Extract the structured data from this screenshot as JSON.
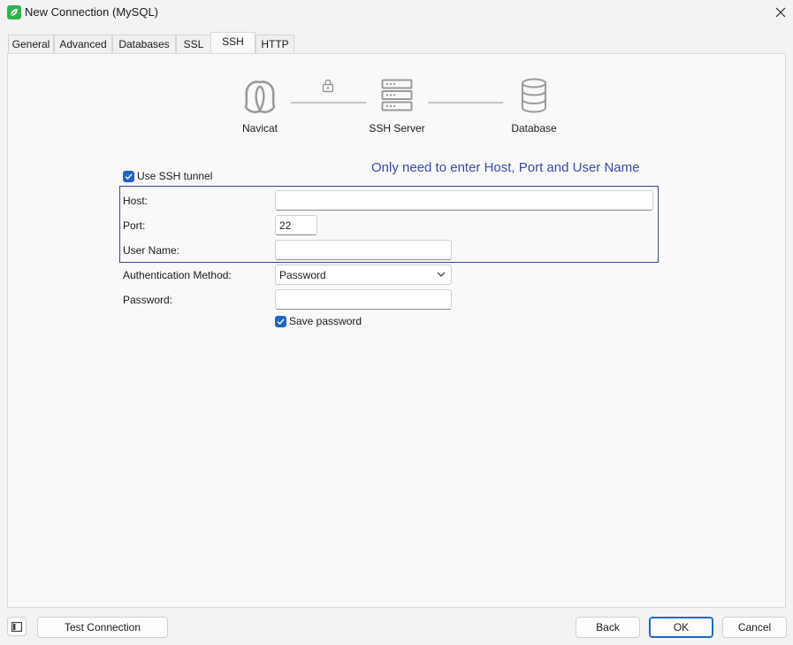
{
  "window": {
    "title": "New Connection (MySQL)"
  },
  "tabs": [
    {
      "label": "General"
    },
    {
      "label": "Advanced"
    },
    {
      "label": "Databases"
    },
    {
      "label": "SSL"
    },
    {
      "label": "SSH"
    },
    {
      "label": "HTTP"
    }
  ],
  "active_tab": "SSH",
  "diagram": {
    "navicat": "Navicat",
    "ssh_server": "SSH Server",
    "database": "Database"
  },
  "note": "Only need to enter Host, Port and User Name",
  "ssh": {
    "use_tunnel_label": "Use SSH tunnel",
    "use_tunnel_checked": true,
    "host_label": "Host:",
    "host_value": "",
    "port_label": "Port:",
    "port_value": "22",
    "username_label": "User Name:",
    "username_value": "",
    "auth_label": "Authentication Method:",
    "auth_value": "Password",
    "password_label": "Password:",
    "password_value": "",
    "save_password_label": "Save password",
    "save_password_checked": true
  },
  "footer": {
    "test_connection": "Test Connection",
    "back": "Back",
    "ok": "OK",
    "cancel": "Cancel"
  },
  "colors": {
    "accent": "#1f66c7",
    "note": "#3b47b5",
    "highlight_border": "#3a3fa0"
  }
}
